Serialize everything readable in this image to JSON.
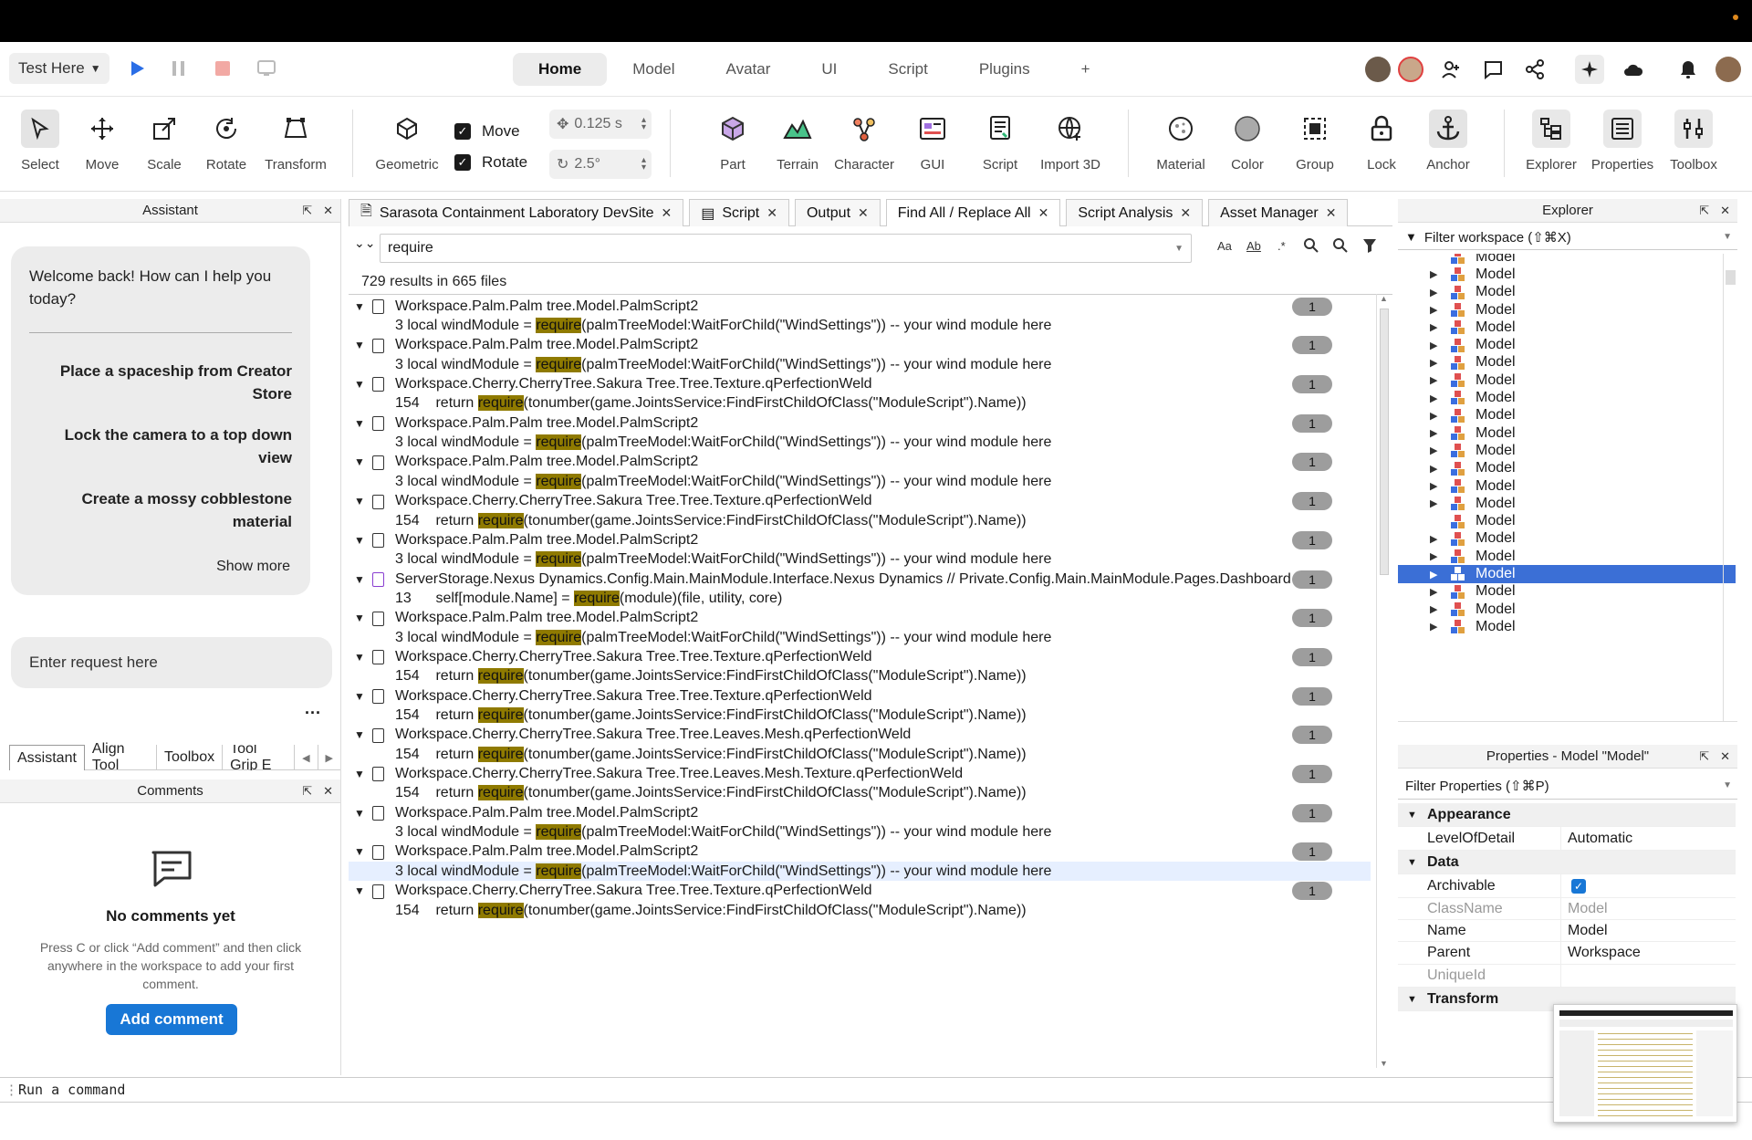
{
  "menubar": {
    "test_label": "Test Here",
    "tabs": [
      "Home",
      "Model",
      "Avatar",
      "UI",
      "Script",
      "Plugins",
      "+"
    ],
    "active_tab": "Home"
  },
  "toolbar": {
    "tools": [
      "Select",
      "Move",
      "Scale",
      "Rotate",
      "Transform"
    ],
    "geometric": "Geometric",
    "move_check": "Move",
    "rotate_check": "Rotate",
    "move_step": "0.125 s",
    "rotate_step": "2.5°",
    "insert": [
      "Part",
      "Terrain",
      "Character",
      "GUI",
      "Script",
      "Import 3D"
    ],
    "edit": [
      "Material",
      "Color",
      "Group",
      "Lock",
      "Anchor"
    ],
    "views": [
      "Explorer",
      "Properties",
      "Toolbox"
    ]
  },
  "assistant": {
    "title": "Assistant",
    "welcome": "Welcome back! How can I help you today?",
    "suggestions": [
      "Place a spaceship from Creator Store",
      "Lock the camera to a top down view",
      "Create a mossy cobblestone material"
    ],
    "show_more": "Show more",
    "input_placeholder": "Enter request here",
    "more": "...",
    "tabs": [
      "Assistant",
      "Align Tool",
      "Toolbox",
      "Tool Grip E"
    ]
  },
  "comments": {
    "title": "Comments",
    "empty_title": "No comments yet",
    "empty_body": "Press C or click “Add comment” and then click anywhere in the workspace to add your first comment.",
    "add_button": "Add comment"
  },
  "doc_tabs": [
    "Sarasota Containment Laboratory DevSite",
    "Script",
    "Output",
    "Find All / Replace All",
    "Script Analysis",
    "Asset Manager"
  ],
  "find": {
    "query": "require",
    "options": [
      "Aa",
      "Ab",
      ".*"
    ],
    "summary": "729 results in 665 files",
    "rows": [
      {
        "t": "file",
        "path": "Workspace.Palm.Palm tree.Model.PalmScript2",
        "count": "1"
      },
      {
        "t": "line",
        "pre": "3 local windModule = ",
        "hit": "require",
        "post": "(palmTreeModel:WaitForChild(\"WindSettings\")) -- your wind module here"
      },
      {
        "t": "file",
        "path": "Workspace.Palm.Palm tree.Model.PalmScript2",
        "count": "1"
      },
      {
        "t": "line",
        "pre": "3 local windModule = ",
        "hit": "require",
        "post": "(palmTreeModel:WaitForChild(\"WindSettings\")) -- your wind module here"
      },
      {
        "t": "file",
        "path": "Workspace.Cherry.CherryTree.Sakura Tree.Tree.Texture.qPerfectionWeld",
        "count": "1"
      },
      {
        "t": "line",
        "pre": "154    return ",
        "hit": "require",
        "post": "(tonumber(game.JointsService:FindFirstChildOfClass(\"ModuleScript\").Name))"
      },
      {
        "t": "file",
        "path": "Workspace.Palm.Palm tree.Model.PalmScript2",
        "count": "1"
      },
      {
        "t": "line",
        "pre": "3 local windModule = ",
        "hit": "require",
        "post": "(palmTreeModel:WaitForChild(\"WindSettings\")) -- your wind module here"
      },
      {
        "t": "file",
        "path": "Workspace.Palm.Palm tree.Model.PalmScript2",
        "count": "1"
      },
      {
        "t": "line",
        "pre": "3 local windModule = ",
        "hit": "require",
        "post": "(palmTreeModel:WaitForChild(\"WindSettings\")) -- your wind module here"
      },
      {
        "t": "file",
        "path": "Workspace.Cherry.CherryTree.Sakura Tree.Tree.Texture.qPerfectionWeld",
        "count": "1"
      },
      {
        "t": "line",
        "pre": "154    return ",
        "hit": "require",
        "post": "(tonumber(game.JointsService:FindFirstChildOfClass(\"ModuleScript\").Name))"
      },
      {
        "t": "file",
        "path": "Workspace.Palm.Palm tree.Model.PalmScript2",
        "count": "1"
      },
      {
        "t": "line",
        "pre": "3 local windModule = ",
        "hit": "require",
        "post": "(palmTreeModel:WaitForChild(\"WindSettings\")) -- your wind module here"
      },
      {
        "t": "file",
        "path": "ServerStorage.Nexus Dynamics.Config.Main.MainModule.Interface.Nexus Dynamics // Private.Config.Main.MainModule.Pages.Dashboard",
        "count": "1",
        "special": true
      },
      {
        "t": "line",
        "pre": "13      self[module.Name] = ",
        "hit": "require",
        "post": "(module)(file, utility, core)"
      },
      {
        "t": "file",
        "path": "Workspace.Palm.Palm tree.Model.PalmScript2",
        "count": "1"
      },
      {
        "t": "line",
        "pre": "3 local windModule = ",
        "hit": "require",
        "post": "(palmTreeModel:WaitForChild(\"WindSettings\")) -- your wind module here"
      },
      {
        "t": "file",
        "path": "Workspace.Cherry.CherryTree.Sakura Tree.Tree.Texture.qPerfectionWeld",
        "count": "1"
      },
      {
        "t": "line",
        "pre": "154    return ",
        "hit": "require",
        "post": "(tonumber(game.JointsService:FindFirstChildOfClass(\"ModuleScript\").Name))"
      },
      {
        "t": "file",
        "path": "Workspace.Cherry.CherryTree.Sakura Tree.Tree.Texture.qPerfectionWeld",
        "count": "1"
      },
      {
        "t": "line",
        "pre": "154    return ",
        "hit": "require",
        "post": "(tonumber(game.JointsService:FindFirstChildOfClass(\"ModuleScript\").Name))"
      },
      {
        "t": "file",
        "path": "Workspace.Cherry.CherryTree.Sakura Tree.Tree.Leaves.Mesh.qPerfectionWeld",
        "count": "1"
      },
      {
        "t": "line",
        "pre": "154    return ",
        "hit": "require",
        "post": "(tonumber(game.JointsService:FindFirstChildOfClass(\"ModuleScript\").Name))"
      },
      {
        "t": "file",
        "path": "Workspace.Cherry.CherryTree.Sakura Tree.Tree.Leaves.Mesh.Texture.qPerfectionWeld",
        "count": "1"
      },
      {
        "t": "line",
        "pre": "154    return ",
        "hit": "require",
        "post": "(tonumber(game.JointsService:FindFirstChildOfClass(\"ModuleScript\").Name))"
      },
      {
        "t": "file",
        "path": "Workspace.Palm.Palm tree.Model.PalmScript2",
        "count": "1"
      },
      {
        "t": "line",
        "pre": "3 local windModule = ",
        "hit": "require",
        "post": "(palmTreeModel:WaitForChild(\"WindSettings\")) -- your wind module here"
      },
      {
        "t": "file",
        "path": "Workspace.Palm.Palm tree.Model.PalmScript2",
        "count": "1"
      },
      {
        "t": "line",
        "pre": "3 local windModule = ",
        "hit": "require",
        "post": "(palmTreeModel:WaitForChild(\"WindSettings\")) -- your wind module here",
        "hl": true
      },
      {
        "t": "file",
        "path": "Workspace.Cherry.CherryTree.Sakura Tree.Tree.Texture.qPerfectionWeld",
        "count": "1"
      },
      {
        "t": "line",
        "pre": "154    return ",
        "hit": "require",
        "post": "(tonumber(game.JointsService:FindFirstChildOfClass(\"ModuleScript\").Name))"
      }
    ]
  },
  "explorer": {
    "title": "Explorer",
    "filter": "Filter workspace (⇧⌘X)",
    "items": [
      {
        "name": "Model",
        "arrow": false
      },
      {
        "name": "Model",
        "arrow": true
      },
      {
        "name": "Model",
        "arrow": true
      },
      {
        "name": "Model",
        "arrow": true
      },
      {
        "name": "Model",
        "arrow": true
      },
      {
        "name": "Model",
        "arrow": true
      },
      {
        "name": "Model",
        "arrow": true
      },
      {
        "name": "Model",
        "arrow": true
      },
      {
        "name": "Model",
        "arrow": true
      },
      {
        "name": "Model",
        "arrow": true
      },
      {
        "name": "Model",
        "arrow": true
      },
      {
        "name": "Model",
        "arrow": true
      },
      {
        "name": "Model",
        "arrow": true
      },
      {
        "name": "Model",
        "arrow": true
      },
      {
        "name": "Model",
        "arrow": true
      },
      {
        "name": "Model",
        "arrow": false
      },
      {
        "name": "Model",
        "arrow": true
      },
      {
        "name": "Model",
        "arrow": true
      },
      {
        "name": "Model",
        "arrow": true,
        "selected": true
      },
      {
        "name": "Model",
        "arrow": true
      },
      {
        "name": "Model",
        "arrow": true
      },
      {
        "name": "Model",
        "arrow": true
      }
    ]
  },
  "properties": {
    "title": "Properties - Model \"Model\"",
    "filter": "Filter Properties (⇧⌘P)",
    "rows": [
      {
        "g": "Appearance"
      },
      {
        "k": "LevelOfDetail",
        "v": "Automatic"
      },
      {
        "g": "Data"
      },
      {
        "k": "Archivable",
        "v": "",
        "check": true
      },
      {
        "k": "ClassName",
        "v": "Model",
        "dim": true
      },
      {
        "k": "Name",
        "v": "Model"
      },
      {
        "k": "Parent",
        "v": "Workspace"
      },
      {
        "k": "UniqueId",
        "v": "",
        "dim": true
      },
      {
        "g": "Transform"
      }
    ]
  },
  "command_bar": {
    "placeholder": "Run a command"
  },
  "colors": {
    "accent": "#1877d6",
    "highlight": "#8f7a00",
    "selection": "#3b6fd6"
  }
}
